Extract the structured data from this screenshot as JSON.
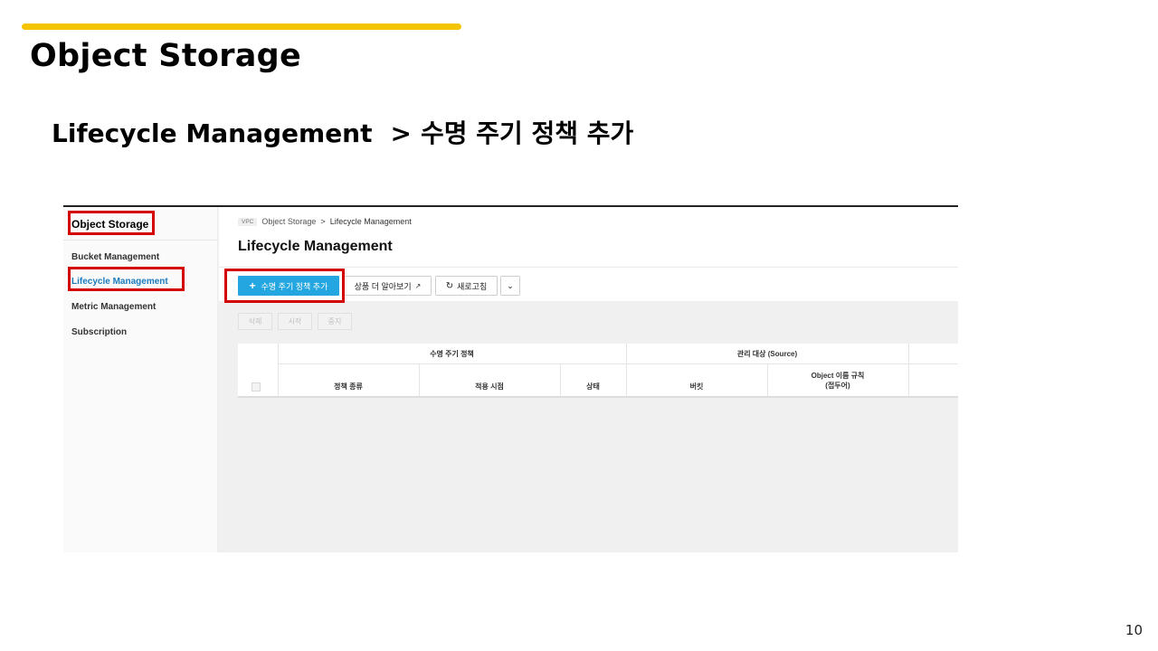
{
  "slide": {
    "title": "Object Storage",
    "subtitle_section": "Lifecycle Management",
    "subtitle_separator": ">",
    "subtitle_action": "수명 주기 정책 추가",
    "page_number": "10",
    "accent_color": "#f5c400",
    "highlight_color": "#d40000"
  },
  "sidebar": {
    "title": "Object Storage",
    "items": [
      {
        "label": "Bucket Management",
        "active": false
      },
      {
        "label": "Lifecycle Management",
        "active": true
      },
      {
        "label": "Metric Management",
        "active": false
      },
      {
        "label": "Subscription",
        "active": false
      }
    ]
  },
  "breadcrumb": {
    "badge": "VPC",
    "parent": "Object Storage",
    "separator": ">",
    "current": "Lifecycle Management"
  },
  "main": {
    "page_title": "Lifecycle Management",
    "toolbar": {
      "add_label": "수명 주기 정책 추가",
      "add_icon": "plus-icon",
      "learn_label": "상품 더 알아보기",
      "learn_icon": "external-link-icon",
      "refresh_label": "새로고침",
      "refresh_icon": "refresh-icon",
      "more_icon": "chevron-down-icon",
      "primary_color": "#24a6e0"
    },
    "actions": {
      "delete_label": "삭제",
      "start_label": "시작",
      "stop_label": "중지"
    },
    "table": {
      "group_policy": "수명 주기 정책",
      "group_target": "관리 대상 (Source)",
      "col_type": "정책 종류",
      "col_apply_time": "적용 시점",
      "col_status": "상태",
      "col_bucket": "버킷",
      "col_object_rule_line1": "Object 이름 규칙",
      "col_object_rule_line2": "(접두어)"
    }
  }
}
